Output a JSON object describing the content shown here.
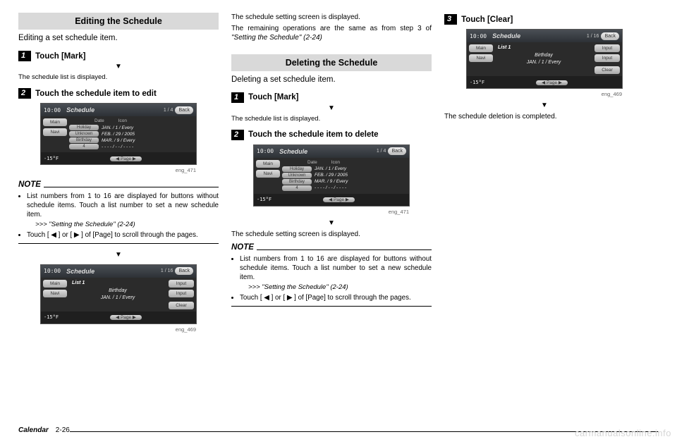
{
  "col1": {
    "section": "Editing the Schedule",
    "intro": "Editing a set schedule item.",
    "step1": {
      "num": "1",
      "txt": "Touch [Mark]"
    },
    "sub1": "The schedule list is displayed.",
    "step2": {
      "num": "2",
      "txt": "Touch the schedule item to edit"
    },
    "shotA": {
      "time": "10:00",
      "title": "Schedule",
      "page": "1 / 4",
      "back": "Back",
      "side": [
        "Main",
        "Navi"
      ],
      "headers": [
        "Date",
        "Icon"
      ],
      "rows": [
        {
          "btn": "Holiday",
          "d": "JAN. /  1 / Every"
        },
        {
          "btn": "Unknown",
          "d": "FEB. / 29 / 2005"
        },
        {
          "btn": "Birthday",
          "d": "MAR. /  9 / Every"
        },
        {
          "btn": "4",
          "d": "- - - - / - - / - - - -"
        }
      ],
      "temp": "-15°F",
      "pager": "◀ Page ▶",
      "cap": "eng_471"
    },
    "noteHd": "NOTE",
    "note1a": "List numbers from 1 to 16 are displayed for buttons without schedule items. Touch a list number to set a new schedule item.",
    "note1aref": ">>> \"Setting the Schedule\" (2-24)",
    "note1b": "Touch [ ◀ ] or [ ▶ ] of [Page] to scroll through the pages.",
    "shotB": {
      "time": "10:00",
      "title": "Schedule",
      "page": "1 / 16",
      "back": "Back",
      "side": [
        "Main",
        "Navi"
      ],
      "listLabel": "List 1",
      "rows": [
        {
          "lbl": "Birthday",
          "btn": "Input"
        },
        {
          "lbl": "JAN. /  1 / Every",
          "btn": "Input"
        }
      ],
      "clear": "Clear",
      "temp": "-15°F",
      "pager": "◀ Page ▶",
      "cap": "eng_469"
    }
  },
  "col2": {
    "topA": "The schedule setting screen is displayed.",
    "topB": "The remaining operations are the same as from step 3 of",
    "topBref": "\"Setting the Schedule\" (2-24)",
    "section": "Deleting the Schedule",
    "intro": "Deleting a set schedule item.",
    "step1": {
      "num": "1",
      "txt": "Touch [Mark]"
    },
    "sub1": "The schedule list is displayed.",
    "step2": {
      "num": "2",
      "txt": "Touch the schedule item to delete"
    },
    "shot": {
      "time": "10:00",
      "title": "Schedule",
      "page": "1 / 4",
      "back": "Back",
      "side": [
        "Main",
        "Navi"
      ],
      "headers": [
        "Date",
        "Icon"
      ],
      "rows": [
        {
          "btn": "Holiday",
          "d": "JAN. /  1 / Every"
        },
        {
          "btn": "Unknown",
          "d": "FEB. / 29 / 2005"
        },
        {
          "btn": "Birthday",
          "d": "MAR. /  9 / Every"
        },
        {
          "btn": "4",
          "d": "- - - - / - - / - - - -"
        }
      ],
      "temp": "-15°F",
      "pager": "◀ Page ▶",
      "cap": "eng_471"
    },
    "after": "The schedule setting screen is displayed.",
    "noteHd": "NOTE",
    "noteA": "List numbers from 1 to 16 are displayed for buttons without schedule items. Touch a list number to set a new schedule item.",
    "noteAref": ">>> \"Setting the Schedule\" (2-24)",
    "noteB": "Touch [ ◀ ] or [ ▶ ] of [Page] to scroll through the pages."
  },
  "col3": {
    "step3": {
      "num": "3",
      "txt": "Touch [Clear]"
    },
    "shot": {
      "time": "10:00",
      "title": "Schedule",
      "page": "1 / 16",
      "back": "Back",
      "side": [
        "Main",
        "Navi"
      ],
      "listLabel": "List 1",
      "rows": [
        {
          "lbl": "Birthday",
          "btn": "Input"
        },
        {
          "lbl": "JAN. /  1 / Every",
          "btn": "Input"
        }
      ],
      "clear": "Clear",
      "temp": "-15°F",
      "pager": "◀ Page ▶",
      "cap": "eng_469"
    },
    "done": "The schedule deletion is completed."
  },
  "footer": {
    "section": "Calendar",
    "page": "2-26"
  },
  "watermark": "carmanualsonline.info"
}
